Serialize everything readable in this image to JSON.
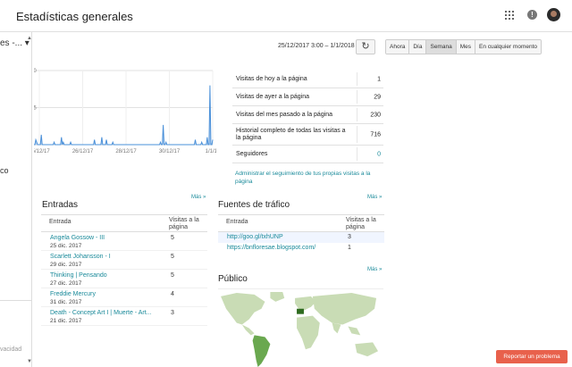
{
  "header": {
    "title": "Estadísticas generales"
  },
  "left": {
    "select_label": "es -...",
    "fragment": "co",
    "footer_fragment": "vacidad"
  },
  "toolbar": {
    "date_range": "25/12/2017 3:00 – 1/1/2018 2:00",
    "refresh_glyph": "↻",
    "ranges": [
      {
        "label": "Ahora",
        "active": false
      },
      {
        "label": "Día",
        "active": false
      },
      {
        "label": "Semana",
        "active": true
      },
      {
        "label": "Mes",
        "active": false
      },
      {
        "label": "En cualquier momento",
        "active": false
      }
    ]
  },
  "chart_data": {
    "type": "area",
    "ylim": [
      0,
      30
    ],
    "yticks": [
      "30",
      "15"
    ],
    "xticks": [
      "25/12/17",
      "26/12/17",
      "28/12/17",
      "30/12/17",
      "1/1/18"
    ],
    "grid": true,
    "color": "#4a90d9",
    "series": [
      {
        "values": [
          0,
          0,
          2,
          1,
          0,
          0,
          0,
          0,
          4,
          0,
          0,
          0,
          0,
          0,
          0,
          0,
          0,
          0,
          0,
          0,
          0,
          0,
          1,
          0,
          0,
          0,
          0,
          0,
          0,
          0,
          3,
          0,
          1,
          0,
          0,
          0,
          0,
          0,
          0,
          0,
          1,
          0,
          0,
          0,
          0,
          0,
          0,
          0,
          0,
          0,
          0,
          0,
          0,
          0,
          0,
          0,
          0,
          0,
          0,
          0,
          0,
          0,
          0,
          0,
          0,
          0,
          2,
          0,
          0,
          0,
          0,
          0,
          0,
          0,
          3,
          0,
          0,
          0,
          0,
          2,
          0,
          0,
          0,
          0,
          0,
          0,
          1,
          0,
          0,
          0,
          0,
          0,
          0,
          0,
          0,
          0,
          0,
          0,
          0,
          0,
          0,
          0,
          0,
          0,
          0,
          0,
          0,
          0,
          0,
          0,
          0,
          0,
          0,
          0,
          0,
          0,
          0,
          0,
          0,
          0,
          0,
          0,
          0,
          0,
          0,
          0,
          0,
          0,
          0,
          0,
          0,
          0,
          0,
          0,
          0,
          0,
          0,
          0,
          1,
          0,
          0,
          8,
          0,
          0,
          1,
          0,
          0,
          0,
          0,
          0,
          0,
          0,
          0,
          0,
          0,
          0,
          0,
          0,
          0,
          0,
          0,
          0,
          0,
          0,
          0,
          0,
          0,
          0,
          0,
          0,
          0,
          0,
          0,
          0,
          0,
          0,
          2,
          0,
          0,
          0,
          0,
          0,
          0,
          1,
          0,
          0,
          0,
          0,
          0,
          3,
          0,
          0,
          24,
          0,
          0,
          2
        ]
      }
    ]
  },
  "stats": {
    "rows": [
      {
        "label": "Visitas de hoy a la página",
        "value": "1"
      },
      {
        "label": "Visitas de ayer a la página",
        "value": "29"
      },
      {
        "label": "Visitas del mes pasado a la página",
        "value": "230"
      },
      {
        "label": "Historial completo de todas las visitas a la página",
        "value": "716"
      },
      {
        "label": "Seguidores",
        "value": "0"
      }
    ],
    "track_link": "Administrar el seguimiento de tus propias visitas a la página"
  },
  "entries": {
    "title": "Entradas",
    "more": "Más »",
    "col_entry": "Entrada",
    "col_visits": "Visitas a la página",
    "rows": [
      {
        "title": "Angela Gossow - III",
        "date": "25 dic. 2017",
        "visits": "5"
      },
      {
        "title": "Scarlett Johansson - I",
        "date": "29 dic. 2017",
        "visits": "5"
      },
      {
        "title": "Thinking | Pensando",
        "date": "27 dic. 2017",
        "visits": "5"
      },
      {
        "title": "Freddie Mercury",
        "date": "31 dic. 2017",
        "visits": "4"
      },
      {
        "title": "Death - Concept Art I | Muerte - Art...",
        "date": "21 dic. 2017",
        "visits": "3"
      }
    ]
  },
  "traffic": {
    "title": "Fuentes de tráfico",
    "more": "Más »",
    "col_entry": "Entrada",
    "col_visits": "Visitas a la página",
    "rows": [
      {
        "url": "http://goo.gl/txhUNP",
        "visits": "3"
      },
      {
        "url": "https://bnfloresae.blogspot.com/",
        "visits": "1"
      }
    ]
  },
  "audience": {
    "title": "Público",
    "more": "Más »"
  },
  "report_button": "Reportar un problema"
}
